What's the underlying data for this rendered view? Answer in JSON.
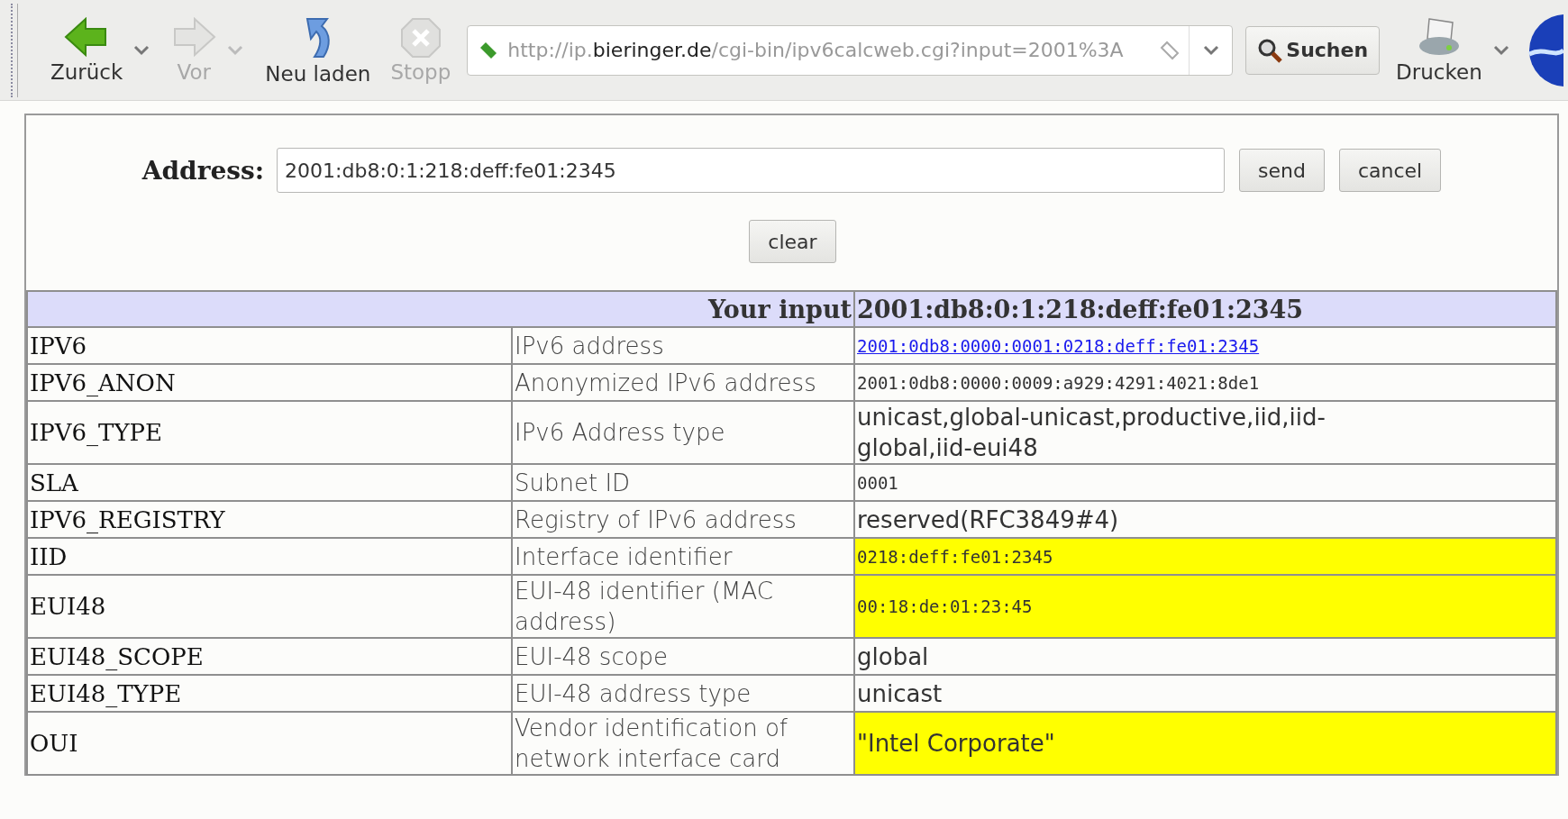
{
  "toolbar": {
    "buttons": [
      {
        "kind": "back",
        "label": "Zurück",
        "disabled": false,
        "dropdown": true
      },
      {
        "kind": "forward",
        "label": "Vor",
        "disabled": true,
        "dropdown": true
      },
      {
        "kind": "reload",
        "label": "Neu laden",
        "disabled": false,
        "dropdown": false
      },
      {
        "kind": "stop",
        "label": "Stopp",
        "disabled": true,
        "dropdown": false
      }
    ],
    "url": [
      {
        "text": "http://ip.",
        "strong": false
      },
      {
        "text": "bieringer.de",
        "strong": true
      },
      {
        "text": "/cgi-bin/ipv6calcweb.cgi?input=2001%3A",
        "strong": false
      }
    ],
    "search_button": "Suchen",
    "print_button": {
      "label": "Drucken",
      "dropdown": true
    }
  },
  "form": {
    "label": "Address:",
    "value": "2001:db8:0:1:218:deff:fe01:2345",
    "buttons": [
      "send",
      "cancel"
    ],
    "clear_button": "clear"
  },
  "table": {
    "header": {
      "label": "Your input",
      "value": "2001:db8:0:1:218:deff:fe01:2345"
    },
    "rows": [
      {
        "name": "IPV6",
        "description": "IPv6 address",
        "value": "2001:0db8:0000:0001:0218:deff:fe01:2345",
        "kind": "link",
        "highlighted": false
      },
      {
        "name": "IPV6_ANON",
        "description": "Anonymized IPv6 address",
        "value": "2001:0db8:0000:0009:a929:4291:4021:8de1",
        "kind": "mono",
        "highlighted": false
      },
      {
        "name": "IPV6_TYPE",
        "description": "IPv6 Address type",
        "value": "unicast,global-unicast,productive,iid,iid-global,iid-eui48",
        "kind": "text",
        "highlighted": false
      },
      {
        "name": "SLA",
        "description": "Subnet ID",
        "value": "0001",
        "kind": "mono",
        "highlighted": false
      },
      {
        "name": "IPV6_REGISTRY",
        "description": "Registry of IPv6 address",
        "value": "reserved(RFC3849#4)",
        "kind": "text",
        "highlighted": false
      },
      {
        "name": "IID",
        "description": "Interface identifier",
        "value": "0218:deff:fe01:2345",
        "kind": "mono",
        "highlighted": true
      },
      {
        "name": "EUI48",
        "description": "EUI-48 identifier (MAC address)",
        "value": "00:18:de:01:23:45",
        "kind": "mono",
        "highlighted": true
      },
      {
        "name": "EUI48_SCOPE",
        "description": "EUI-48 scope",
        "value": "global",
        "kind": "text",
        "highlighted": false
      },
      {
        "name": "EUI48_TYPE",
        "description": "EUI-48 address type",
        "value": "unicast",
        "kind": "text",
        "highlighted": false
      },
      {
        "name": "OUI",
        "description": "Vendor identification of network interface card",
        "value": "\"Intel Corporate\"",
        "kind": "text",
        "highlighted": true
      }
    ]
  }
}
